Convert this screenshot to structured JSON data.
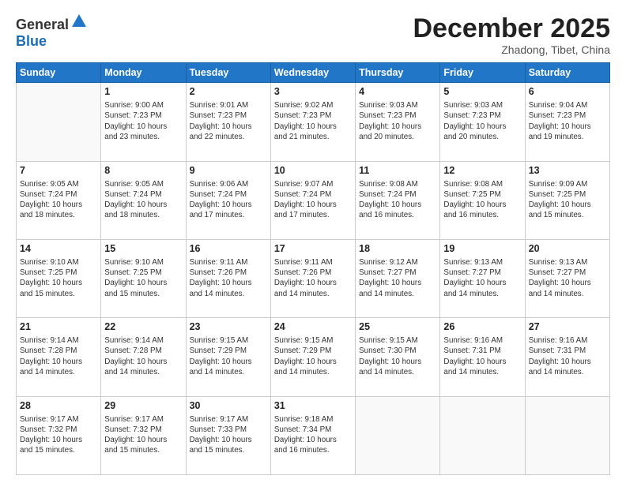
{
  "logo": {
    "general": "General",
    "blue": "Blue"
  },
  "header": {
    "month": "December 2025",
    "location": "Zhadong, Tibet, China"
  },
  "weekdays": [
    "Sunday",
    "Monday",
    "Tuesday",
    "Wednesday",
    "Thursday",
    "Friday",
    "Saturday"
  ],
  "weeks": [
    [
      {
        "day": null,
        "info": null
      },
      {
        "day": "1",
        "info": "Sunrise: 9:00 AM\nSunset: 7:23 PM\nDaylight: 10 hours\nand 23 minutes."
      },
      {
        "day": "2",
        "info": "Sunrise: 9:01 AM\nSunset: 7:23 PM\nDaylight: 10 hours\nand 22 minutes."
      },
      {
        "day": "3",
        "info": "Sunrise: 9:02 AM\nSunset: 7:23 PM\nDaylight: 10 hours\nand 21 minutes."
      },
      {
        "day": "4",
        "info": "Sunrise: 9:03 AM\nSunset: 7:23 PM\nDaylight: 10 hours\nand 20 minutes."
      },
      {
        "day": "5",
        "info": "Sunrise: 9:03 AM\nSunset: 7:23 PM\nDaylight: 10 hours\nand 20 minutes."
      },
      {
        "day": "6",
        "info": "Sunrise: 9:04 AM\nSunset: 7:23 PM\nDaylight: 10 hours\nand 19 minutes."
      }
    ],
    [
      {
        "day": "7",
        "info": "Sunrise: 9:05 AM\nSunset: 7:24 PM\nDaylight: 10 hours\nand 18 minutes."
      },
      {
        "day": "8",
        "info": "Sunrise: 9:05 AM\nSunset: 7:24 PM\nDaylight: 10 hours\nand 18 minutes."
      },
      {
        "day": "9",
        "info": "Sunrise: 9:06 AM\nSunset: 7:24 PM\nDaylight: 10 hours\nand 17 minutes."
      },
      {
        "day": "10",
        "info": "Sunrise: 9:07 AM\nSunset: 7:24 PM\nDaylight: 10 hours\nand 17 minutes."
      },
      {
        "day": "11",
        "info": "Sunrise: 9:08 AM\nSunset: 7:24 PM\nDaylight: 10 hours\nand 16 minutes."
      },
      {
        "day": "12",
        "info": "Sunrise: 9:08 AM\nSunset: 7:25 PM\nDaylight: 10 hours\nand 16 minutes."
      },
      {
        "day": "13",
        "info": "Sunrise: 9:09 AM\nSunset: 7:25 PM\nDaylight: 10 hours\nand 15 minutes."
      }
    ],
    [
      {
        "day": "14",
        "info": "Sunrise: 9:10 AM\nSunset: 7:25 PM\nDaylight: 10 hours\nand 15 minutes."
      },
      {
        "day": "15",
        "info": "Sunrise: 9:10 AM\nSunset: 7:25 PM\nDaylight: 10 hours\nand 15 minutes."
      },
      {
        "day": "16",
        "info": "Sunrise: 9:11 AM\nSunset: 7:26 PM\nDaylight: 10 hours\nand 14 minutes."
      },
      {
        "day": "17",
        "info": "Sunrise: 9:11 AM\nSunset: 7:26 PM\nDaylight: 10 hours\nand 14 minutes."
      },
      {
        "day": "18",
        "info": "Sunrise: 9:12 AM\nSunset: 7:27 PM\nDaylight: 10 hours\nand 14 minutes."
      },
      {
        "day": "19",
        "info": "Sunrise: 9:13 AM\nSunset: 7:27 PM\nDaylight: 10 hours\nand 14 minutes."
      },
      {
        "day": "20",
        "info": "Sunrise: 9:13 AM\nSunset: 7:27 PM\nDaylight: 10 hours\nand 14 minutes."
      }
    ],
    [
      {
        "day": "21",
        "info": "Sunrise: 9:14 AM\nSunset: 7:28 PM\nDaylight: 10 hours\nand 14 minutes."
      },
      {
        "day": "22",
        "info": "Sunrise: 9:14 AM\nSunset: 7:28 PM\nDaylight: 10 hours\nand 14 minutes."
      },
      {
        "day": "23",
        "info": "Sunrise: 9:15 AM\nSunset: 7:29 PM\nDaylight: 10 hours\nand 14 minutes."
      },
      {
        "day": "24",
        "info": "Sunrise: 9:15 AM\nSunset: 7:29 PM\nDaylight: 10 hours\nand 14 minutes."
      },
      {
        "day": "25",
        "info": "Sunrise: 9:15 AM\nSunset: 7:30 PM\nDaylight: 10 hours\nand 14 minutes."
      },
      {
        "day": "26",
        "info": "Sunrise: 9:16 AM\nSunset: 7:31 PM\nDaylight: 10 hours\nand 14 minutes."
      },
      {
        "day": "27",
        "info": "Sunrise: 9:16 AM\nSunset: 7:31 PM\nDaylight: 10 hours\nand 14 minutes."
      }
    ],
    [
      {
        "day": "28",
        "info": "Sunrise: 9:17 AM\nSunset: 7:32 PM\nDaylight: 10 hours\nand 15 minutes."
      },
      {
        "day": "29",
        "info": "Sunrise: 9:17 AM\nSunset: 7:32 PM\nDaylight: 10 hours\nand 15 minutes."
      },
      {
        "day": "30",
        "info": "Sunrise: 9:17 AM\nSunset: 7:33 PM\nDaylight: 10 hours\nand 15 minutes."
      },
      {
        "day": "31",
        "info": "Sunrise: 9:18 AM\nSunset: 7:34 PM\nDaylight: 10 hours\nand 16 minutes."
      },
      {
        "day": null,
        "info": null
      },
      {
        "day": null,
        "info": null
      },
      {
        "day": null,
        "info": null
      }
    ]
  ]
}
